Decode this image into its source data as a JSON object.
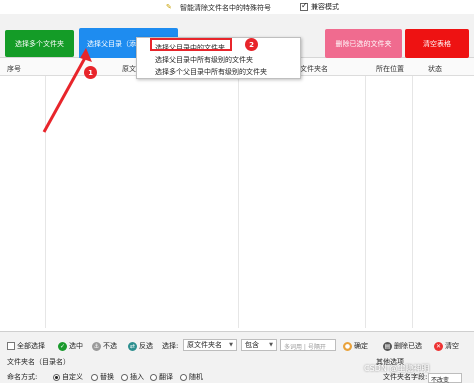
{
  "window": {
    "title": "智能清除文件名中的特殊符号",
    "compat_mode_label": "兼容模式",
    "compat_mode_checked": true
  },
  "toolbar": {
    "select_multiple_folders": "选择多个文件夹",
    "select_parent_dir": "选择父目录（添",
    "delete_selected_folders": "删除已选的文件夹",
    "clear_table": "清空表格"
  },
  "dropdown_menu": {
    "items": [
      "选择父目录中的文件夹",
      "选择父目录中所有级别的文件夹",
      "选择多个父目录中所有级别的文件夹"
    ],
    "highlighted_index": 0
  },
  "table": {
    "columns": {
      "index": "序号",
      "original": "原文",
      "folder_name": "文件夹名",
      "location": "所在位置",
      "status": "状态"
    },
    "rows": []
  },
  "annotations": {
    "step1": "1",
    "step2": "2"
  },
  "bottom_bar": {
    "select_all": "全部选择",
    "select_checked": "选中",
    "unselect": "不选",
    "invert": "反选",
    "select_by_label": "选择:",
    "field_select": "原文件夹名",
    "match_select": "包含",
    "separator_placeholder": "多词用 | 号隔开",
    "confirm": "确定",
    "delete_selected": "删除已选",
    "clear": "清空"
  },
  "folder_section": {
    "label": "文件夹名（目录名）",
    "other_options": "其他选项"
  },
  "naming": {
    "label": "命名方式:",
    "options": [
      "自定义",
      "替换",
      "插入",
      "翻译",
      "随机"
    ],
    "selected_index": 0,
    "folder_name_label": "文件夹名字段:",
    "folder_name_value": "不改变"
  },
  "watermark": "CSDN @尘隐神明"
}
